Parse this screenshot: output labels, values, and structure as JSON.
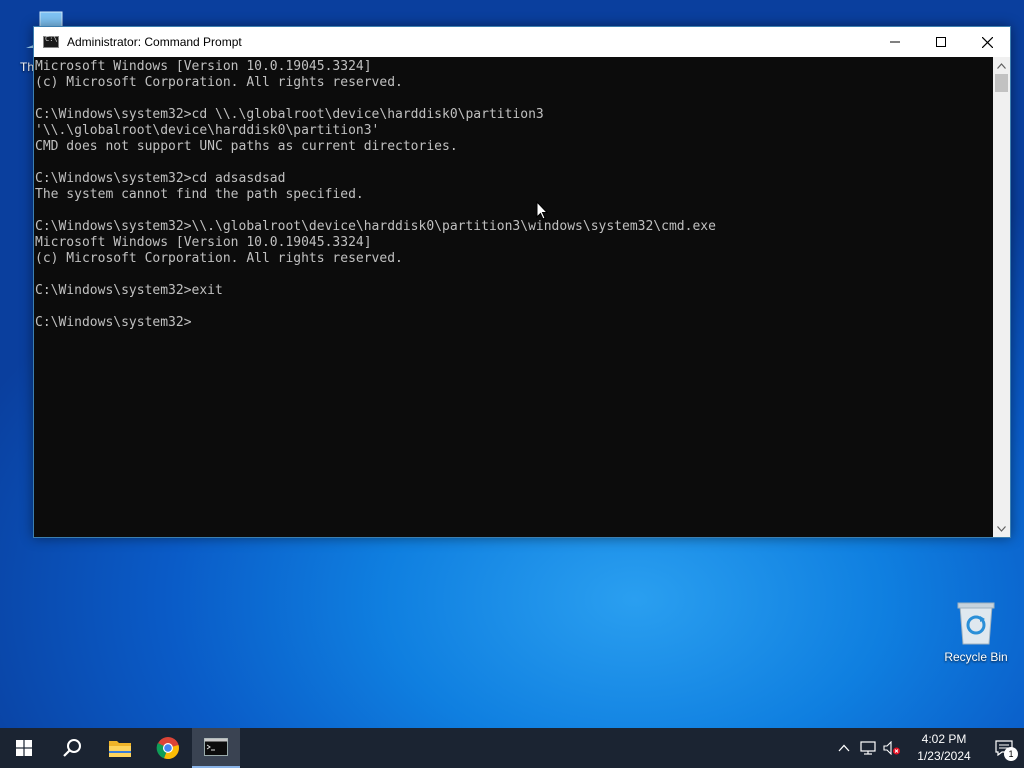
{
  "desktop": {
    "this_pc_label": "Th",
    "recycle_bin_label": "Recycle Bin"
  },
  "window": {
    "title": "Administrator: Command Prompt",
    "buttons": {
      "minimize": "minimize-icon",
      "maximize": "maximize-icon",
      "close": "close-icon"
    }
  },
  "console": {
    "lines": [
      "Microsoft Windows [Version 10.0.19045.3324]",
      "(c) Microsoft Corporation. All rights reserved.",
      "",
      "C:\\Windows\\system32>cd \\\\.\\globalroot\\device\\harddisk0\\partition3",
      "'\\\\.\\globalroot\\device\\harddisk0\\partition3'",
      "CMD does not support UNC paths as current directories.",
      "",
      "C:\\Windows\\system32>cd adsasdsad",
      "The system cannot find the path specified.",
      "",
      "C:\\Windows\\system32>\\\\.\\globalroot\\device\\harddisk0\\partition3\\windows\\system32\\cmd.exe",
      "Microsoft Windows [Version 10.0.19045.3324]",
      "(c) Microsoft Corporation. All rights reserved.",
      "",
      "C:\\Windows\\system32>exit",
      "",
      "C:\\Windows\\system32>"
    ],
    "text_color": "#c0c0c0",
    "background": "#0c0c0c"
  },
  "taskbar": {
    "items": [
      "start-icon",
      "search-icon",
      "file-explorer-icon",
      "chrome-icon",
      "command-prompt-icon"
    ],
    "clock": {
      "time": "4:02 PM",
      "date": "1/23/2024"
    },
    "notification_count": "1"
  }
}
